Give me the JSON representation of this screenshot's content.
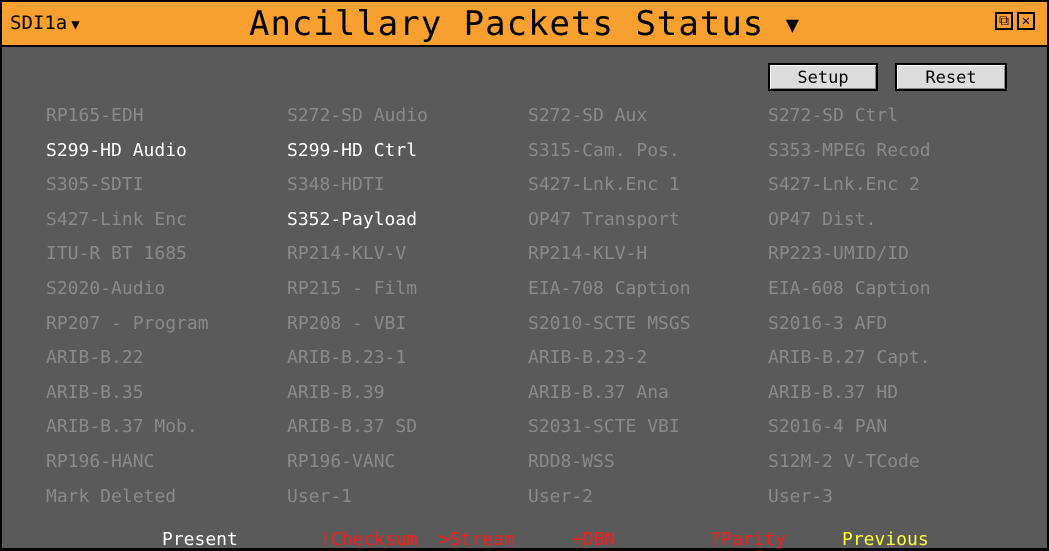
{
  "window": {
    "source_label": "SDI1a",
    "source_arrow": "▼",
    "title": "Ancillary Packets Status",
    "title_arrow": "▼",
    "restore_glyph": "⧉",
    "close_glyph": "✕"
  },
  "toolbar": {
    "setup_label": "Setup",
    "reset_label": "Reset"
  },
  "packets": [
    [
      {
        "label": "RP165-EDH",
        "state": "absent"
      },
      {
        "label": "S272-SD Audio",
        "state": "absent"
      },
      {
        "label": "S272-SD Aux",
        "state": "absent"
      },
      {
        "label": "S272-SD Ctrl",
        "state": "absent"
      }
    ],
    [
      {
        "label": "S299-HD Audio",
        "state": "present"
      },
      {
        "label": "S299-HD Ctrl",
        "state": "present"
      },
      {
        "label": "S315-Cam. Pos.",
        "state": "absent"
      },
      {
        "label": "S353-MPEG Recod",
        "state": "absent"
      }
    ],
    [
      {
        "label": "S305-SDTI",
        "state": "absent"
      },
      {
        "label": "S348-HDTI",
        "state": "absent"
      },
      {
        "label": "S427-Lnk.Enc 1",
        "state": "absent"
      },
      {
        "label": "S427-Lnk.Enc 2",
        "state": "absent"
      }
    ],
    [
      {
        "label": "S427-Link Enc",
        "state": "absent"
      },
      {
        "label": "S352-Payload",
        "state": "present"
      },
      {
        "label": "OP47 Transport",
        "state": "absent"
      },
      {
        "label": "OP47 Dist.",
        "state": "absent"
      }
    ],
    [
      {
        "label": "ITU-R BT 1685",
        "state": "absent"
      },
      {
        "label": "RP214-KLV-V",
        "state": "absent"
      },
      {
        "label": "RP214-KLV-H",
        "state": "absent"
      },
      {
        "label": "RP223-UMID/ID",
        "state": "absent"
      }
    ],
    [
      {
        "label": "S2020-Audio",
        "state": "absent"
      },
      {
        "label": "RP215 - Film",
        "state": "absent"
      },
      {
        "label": "EIA-708 Caption",
        "state": "absent"
      },
      {
        "label": "EIA-608 Caption",
        "state": "absent"
      }
    ],
    [
      {
        "label": "RP207 - Program",
        "state": "absent"
      },
      {
        "label": "RP208 - VBI",
        "state": "absent"
      },
      {
        "label": "S2010-SCTE MSGS",
        "state": "absent"
      },
      {
        "label": "S2016-3 AFD",
        "state": "absent"
      }
    ],
    [
      {
        "label": "ARIB-B.22",
        "state": "absent"
      },
      {
        "label": "ARIB-B.23-1",
        "state": "absent"
      },
      {
        "label": "ARIB-B.23-2",
        "state": "absent"
      },
      {
        "label": "ARIB-B.27 Capt.",
        "state": "absent"
      }
    ],
    [
      {
        "label": "ARIB-B.35",
        "state": "absent"
      },
      {
        "label": "ARIB-B.39",
        "state": "absent"
      },
      {
        "label": "ARIB-B.37 Ana",
        "state": "absent"
      },
      {
        "label": "ARIB-B.37 HD",
        "state": "absent"
      }
    ],
    [
      {
        "label": "ARIB-B.37 Mob.",
        "state": "absent"
      },
      {
        "label": "ARIB-B.37 SD",
        "state": "absent"
      },
      {
        "label": "S2031-SCTE VBI",
        "state": "absent"
      },
      {
        "label": "S2016-4 PAN",
        "state": "absent"
      }
    ],
    [
      {
        "label": "RP196-HANC",
        "state": "absent"
      },
      {
        "label": "RP196-VANC",
        "state": "absent"
      },
      {
        "label": "RDD8-WSS",
        "state": "absent"
      },
      {
        "label": "S12M-2 V-TCode",
        "state": "absent"
      }
    ],
    [
      {
        "label": "Mark Deleted",
        "state": "absent"
      },
      {
        "label": "User-1",
        "state": "absent"
      },
      {
        "label": "User-2",
        "state": "absent"
      },
      {
        "label": "User-3",
        "state": "absent"
      }
    ]
  ],
  "legend": [
    {
      "label": "Present",
      "color": "#ffffff"
    },
    {
      "label": "!Checksum",
      "color": "#ff1a1a"
    },
    {
      "label": ">Stream",
      "color": "#ff1a1a"
    },
    {
      "label": "+DBN",
      "color": "#ff1a1a"
    },
    {
      "label": "?Parity",
      "color": "#ff1a1a"
    },
    {
      "label": "Previous",
      "color": "#ffff33"
    }
  ],
  "colors": {
    "titlebar": "#f7a030",
    "background": "#5a5a5a",
    "absent_text": "#8a8a8a",
    "present_text": "#ffffff"
  }
}
